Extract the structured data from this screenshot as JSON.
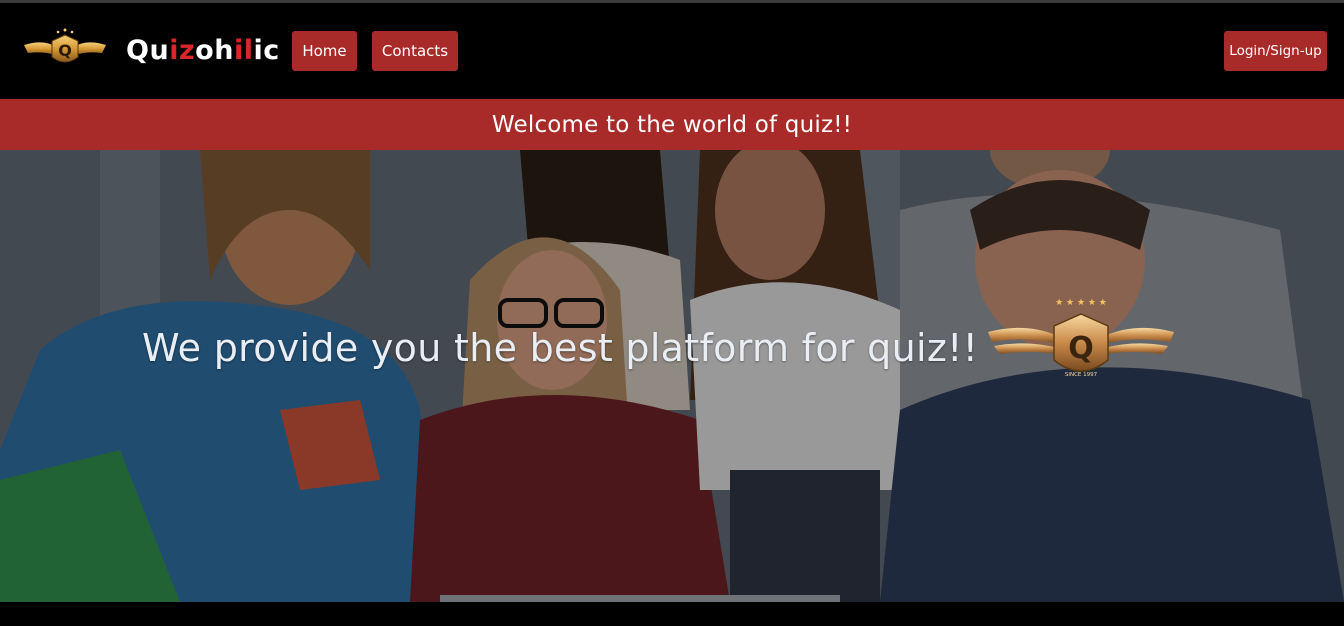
{
  "brand": {
    "name_parts": [
      {
        "text": "Qu",
        "red": false
      },
      {
        "text": "iz",
        "red": true
      },
      {
        "text": "oh",
        "red": false
      },
      {
        "text": "il",
        "red": true
      },
      {
        "text": "ic",
        "red": false
      }
    ],
    "emblem_letter": "Q",
    "emblem_caption": "SINCE 1997"
  },
  "nav": {
    "home_label": "Home",
    "contacts_label": "Contacts",
    "login_label": "Login/Sign-up"
  },
  "banner": {
    "text": "Welcome to the world of quiz!!"
  },
  "hero": {
    "tagline": "We provide you the best platform for quiz!!"
  },
  "colors": {
    "accent_red": "#a82a29",
    "brand_red": "#d9262a",
    "background": "#000000",
    "gold": "#d9a441"
  }
}
